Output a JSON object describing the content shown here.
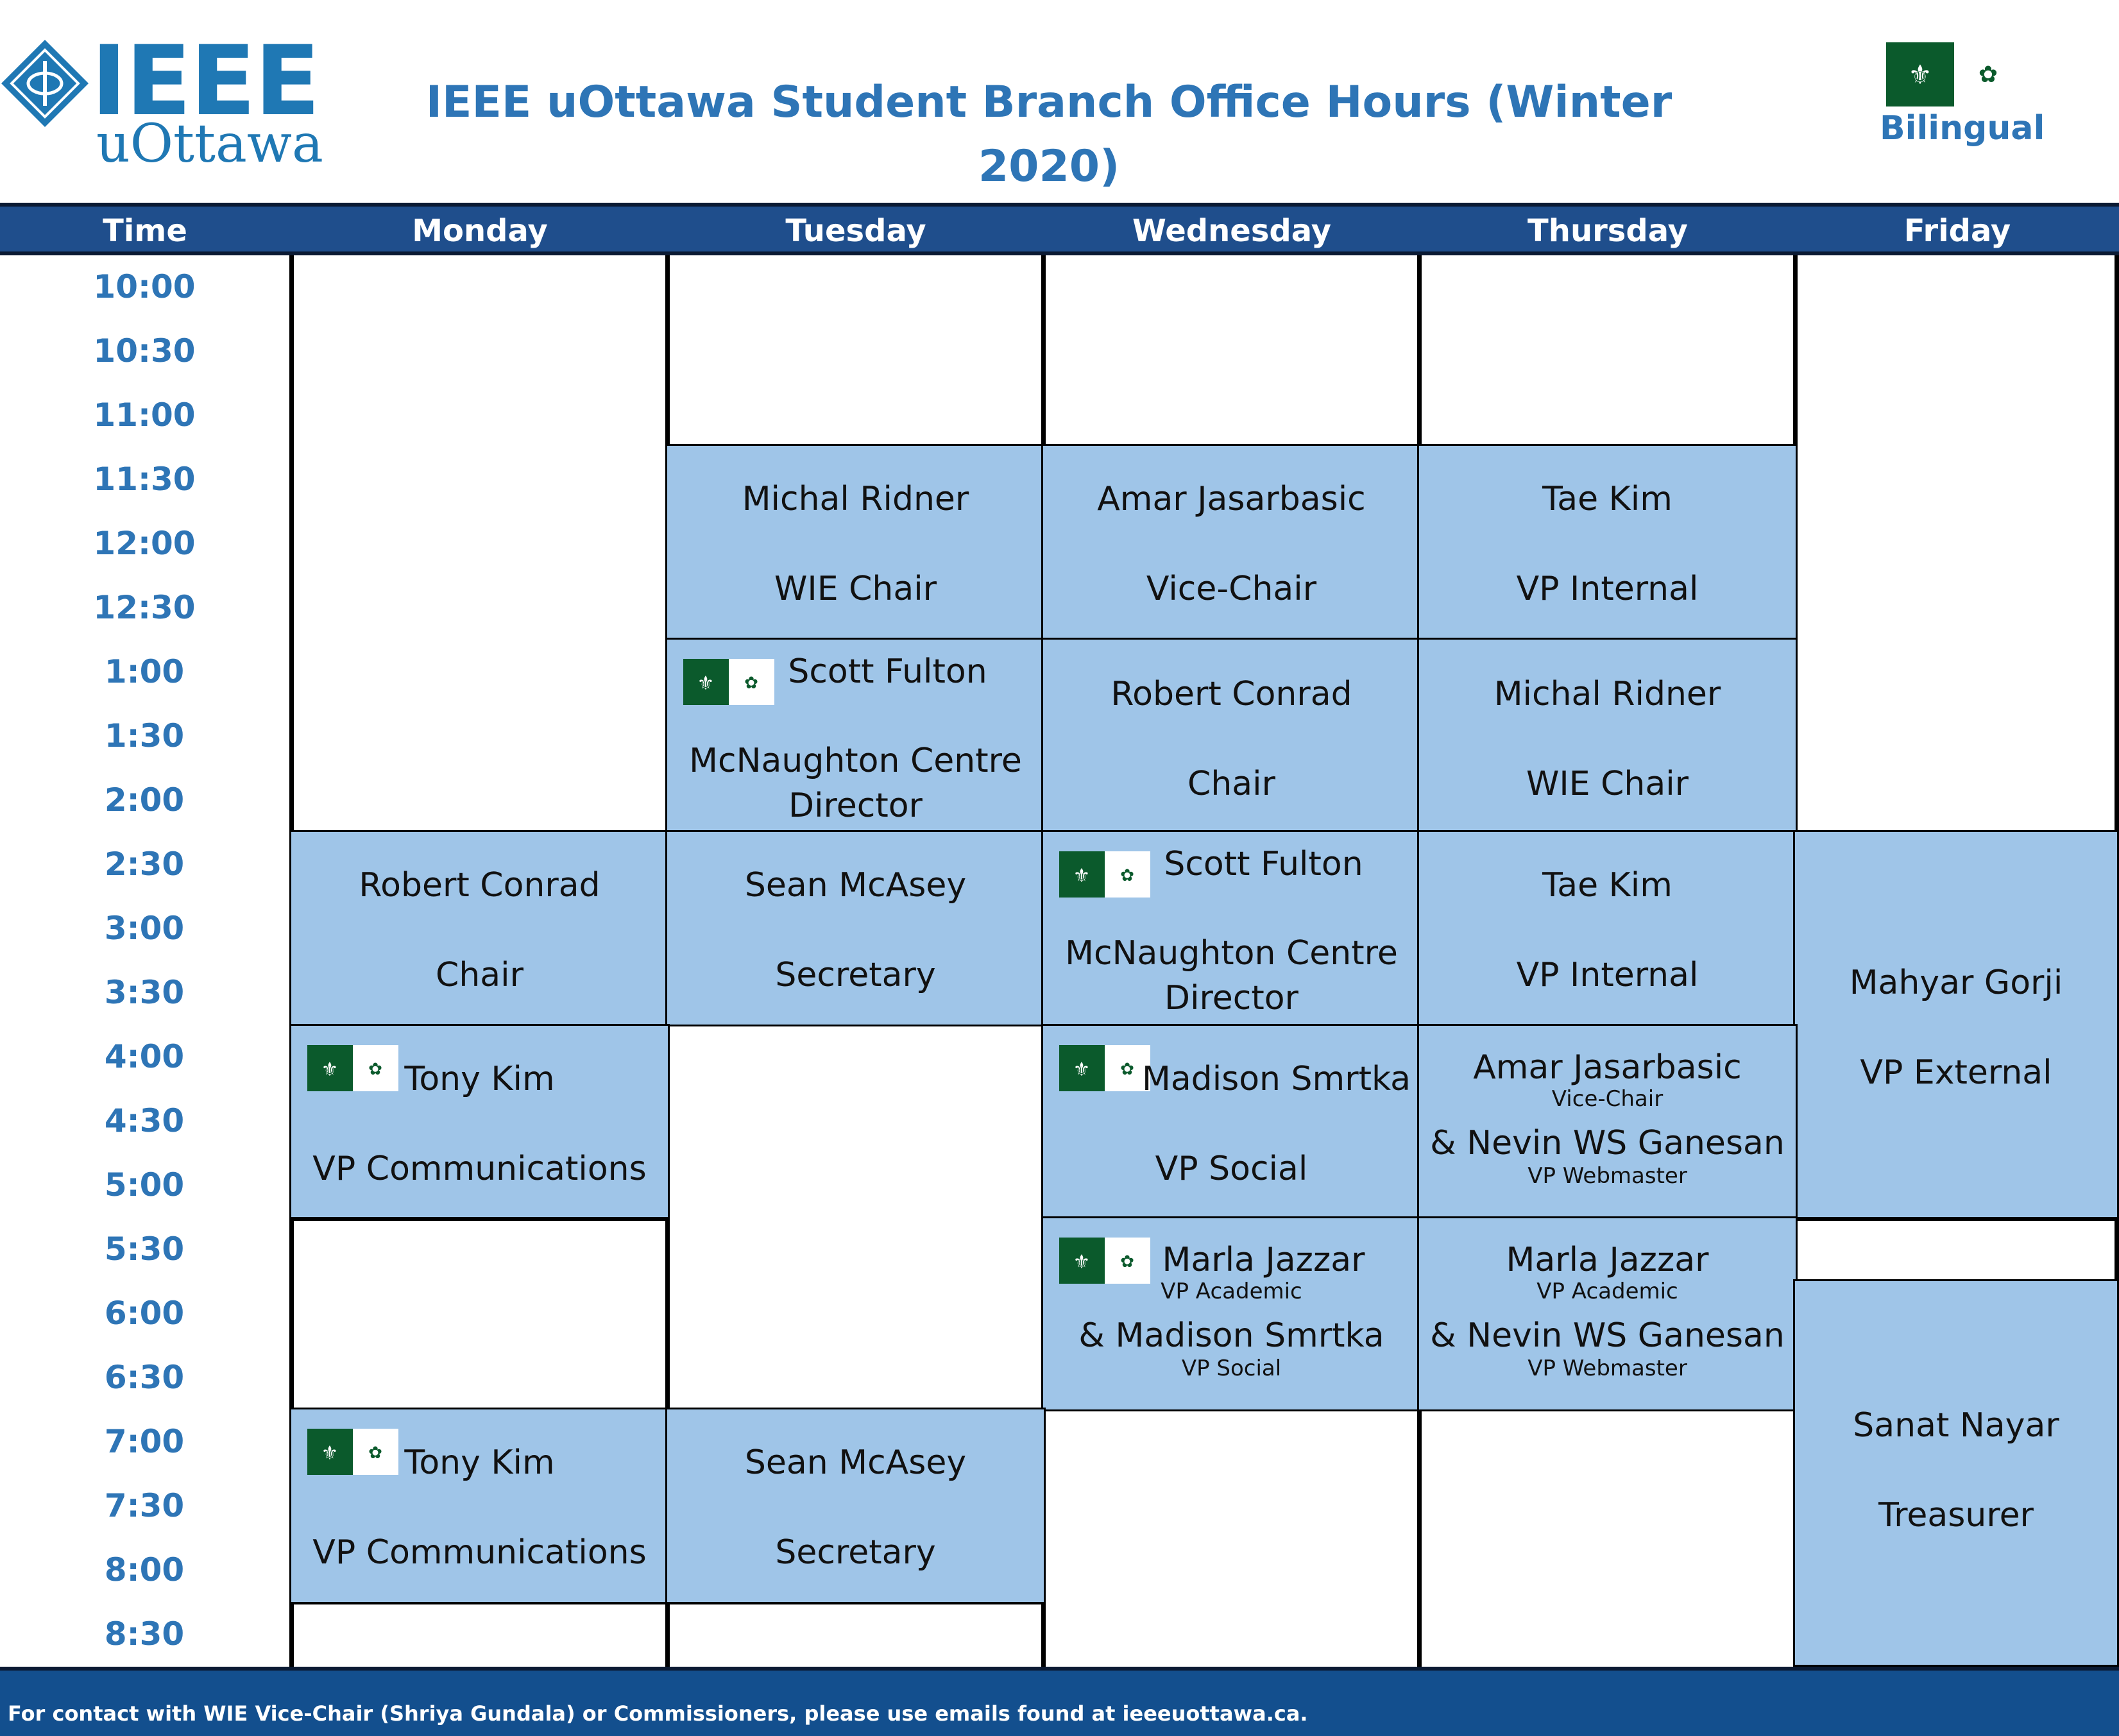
{
  "header": {
    "logo_text": "IEEE",
    "logo_sub": "uOttawa",
    "title": "IEEE uOttawa Student Branch Office Hours (Winter 2020)",
    "legend_label": "Bilingual"
  },
  "columns": {
    "time": "Time",
    "days": [
      "Monday",
      "Tuesday",
      "Wednesday",
      "Thursday",
      "Friday"
    ]
  },
  "times": [
    "10:00",
    "10:30",
    "11:00",
    "11:30",
    "12:00",
    "12:30",
    "1:00",
    "1:30",
    "2:00",
    "2:30",
    "3:00",
    "3:30",
    "4:00",
    "4:30",
    "5:00",
    "5:30",
    "6:00",
    "6:30",
    "7:00",
    "7:30",
    "8:00",
    "8:30"
  ],
  "slots": {
    "tue_1130": {
      "name": "Michal Ridner",
      "role": "WIE Chair"
    },
    "wed_1130": {
      "name": "Amar Jasarbasic",
      "role": "Vice-Chair"
    },
    "thu_1130": {
      "name": "Tae Kim",
      "role": "VP Internal"
    },
    "tue_100": {
      "name": "Scott Fulton",
      "role_line1": "McNaughton Centre",
      "role_line2": "Director",
      "bilingual": true
    },
    "wed_100": {
      "name": "Robert Conrad",
      "role": "Chair"
    },
    "thu_100": {
      "name": "Michal Ridner",
      "role": "WIE Chair"
    },
    "mon_230": {
      "name": "Robert Conrad",
      "role": "Chair"
    },
    "tue_230": {
      "name": "Sean McAsey",
      "role": "Secretary"
    },
    "wed_230": {
      "name": "Scott Fulton",
      "role_line1": "McNaughton Centre",
      "role_line2": "Director",
      "bilingual": true
    },
    "thu_230": {
      "name": "Tae Kim",
      "role": "VP Internal"
    },
    "fri_230": {
      "name": "Mahyar Gorji",
      "role": "VP External"
    },
    "mon_400": {
      "name": "Tony Kim",
      "role": "VP Communications",
      "bilingual": true
    },
    "wed_400": {
      "name": "Madison Smrtka",
      "role": "VP Social",
      "bilingual": true
    },
    "thu_400": {
      "name": "Amar Jasarbasic",
      "sub1": "Vice-Chair",
      "name2": "& Nevin WS Ganesan",
      "sub2": "VP Webmaster"
    },
    "wed_530": {
      "name": "Marla Jazzar",
      "sub1": "VP Academic",
      "name2": "& Madison Smrtka",
      "sub2": "VP Social",
      "bilingual": true
    },
    "thu_530": {
      "name": "Marla Jazzar",
      "sub1": "VP Academic",
      "name2": "& Nevin WS Ganesan",
      "sub2": "VP Webmaster"
    },
    "fri_600": {
      "name": "Sanat Nayar",
      "role": "Treasurer"
    },
    "mon_700": {
      "name": "Tony Kim",
      "role": "VP Communications",
      "bilingual": true
    },
    "tue_700": {
      "name": "Sean McAsey",
      "role": "Secretary"
    }
  },
  "colors": {
    "header_bg": "#1f4e8c",
    "slot_bg": "#9fc5e8",
    "title": "#2e75b6",
    "flag_green": "#0b5a2c"
  },
  "footer": {
    "text": "For contact with WIE Vice-Chair (Shriya Gundala) or Commissioners, please use emails found at ieeeuottawa.ca."
  }
}
